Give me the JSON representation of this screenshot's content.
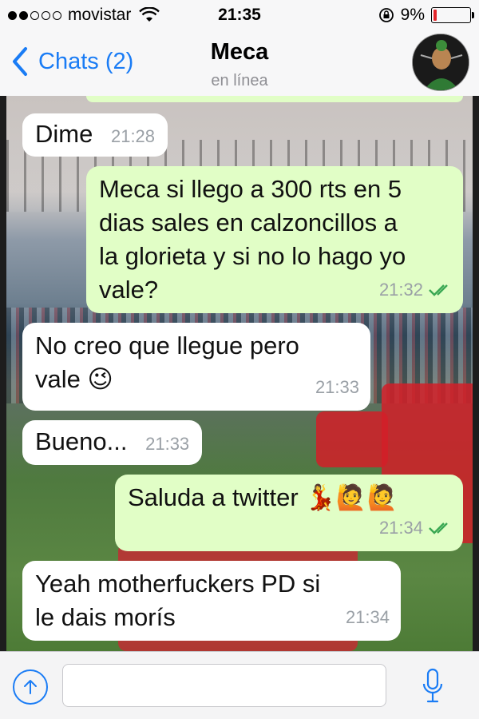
{
  "status_bar": {
    "carrier": "movistar",
    "time": "21:35",
    "battery": "9%",
    "battery_level": 0.09,
    "signal_bars_filled": 2,
    "signal_bars_total": 5
  },
  "nav": {
    "back_label": "Chats (2)",
    "contact_name": "Meca",
    "contact_status": "en línea"
  },
  "messages": [
    {
      "direction": "in",
      "text": "Dime",
      "time": "21:28"
    },
    {
      "direction": "out",
      "text": "Meca si llego a 300 rts en 5\ndias sales en calzoncillos a\nla glorieta y si no lo hago yo\nvale?",
      "time": "21:32",
      "read": true
    },
    {
      "direction": "in",
      "text": "No creo que llegue pero\nvale 😉",
      "time": "21:33"
    },
    {
      "direction": "in",
      "text": "Bueno...",
      "time": "21:33"
    },
    {
      "direction": "out",
      "text": "Saluda a twitter 💃🙋🙋",
      "time": "21:34",
      "read": true
    },
    {
      "direction": "in",
      "text": "Yeah motherfuckers PD si\nle dais morís",
      "time": "21:34"
    }
  ],
  "input": {
    "placeholder": ""
  },
  "colors": {
    "accent": "#1a7cf5",
    "outgoing_bubble": "#e1fec6",
    "incoming_bubble": "#ffffff",
    "read_ticks": "#34b7f1",
    "battery_low": "#e4262b"
  },
  "icons": {
    "back": "chevron-left-icon",
    "attach": "upload-arrow-icon",
    "mic": "microphone-icon",
    "wifi": "wifi-icon",
    "rotation_lock": "rotation-lock-icon",
    "read": "double-check-icon"
  }
}
